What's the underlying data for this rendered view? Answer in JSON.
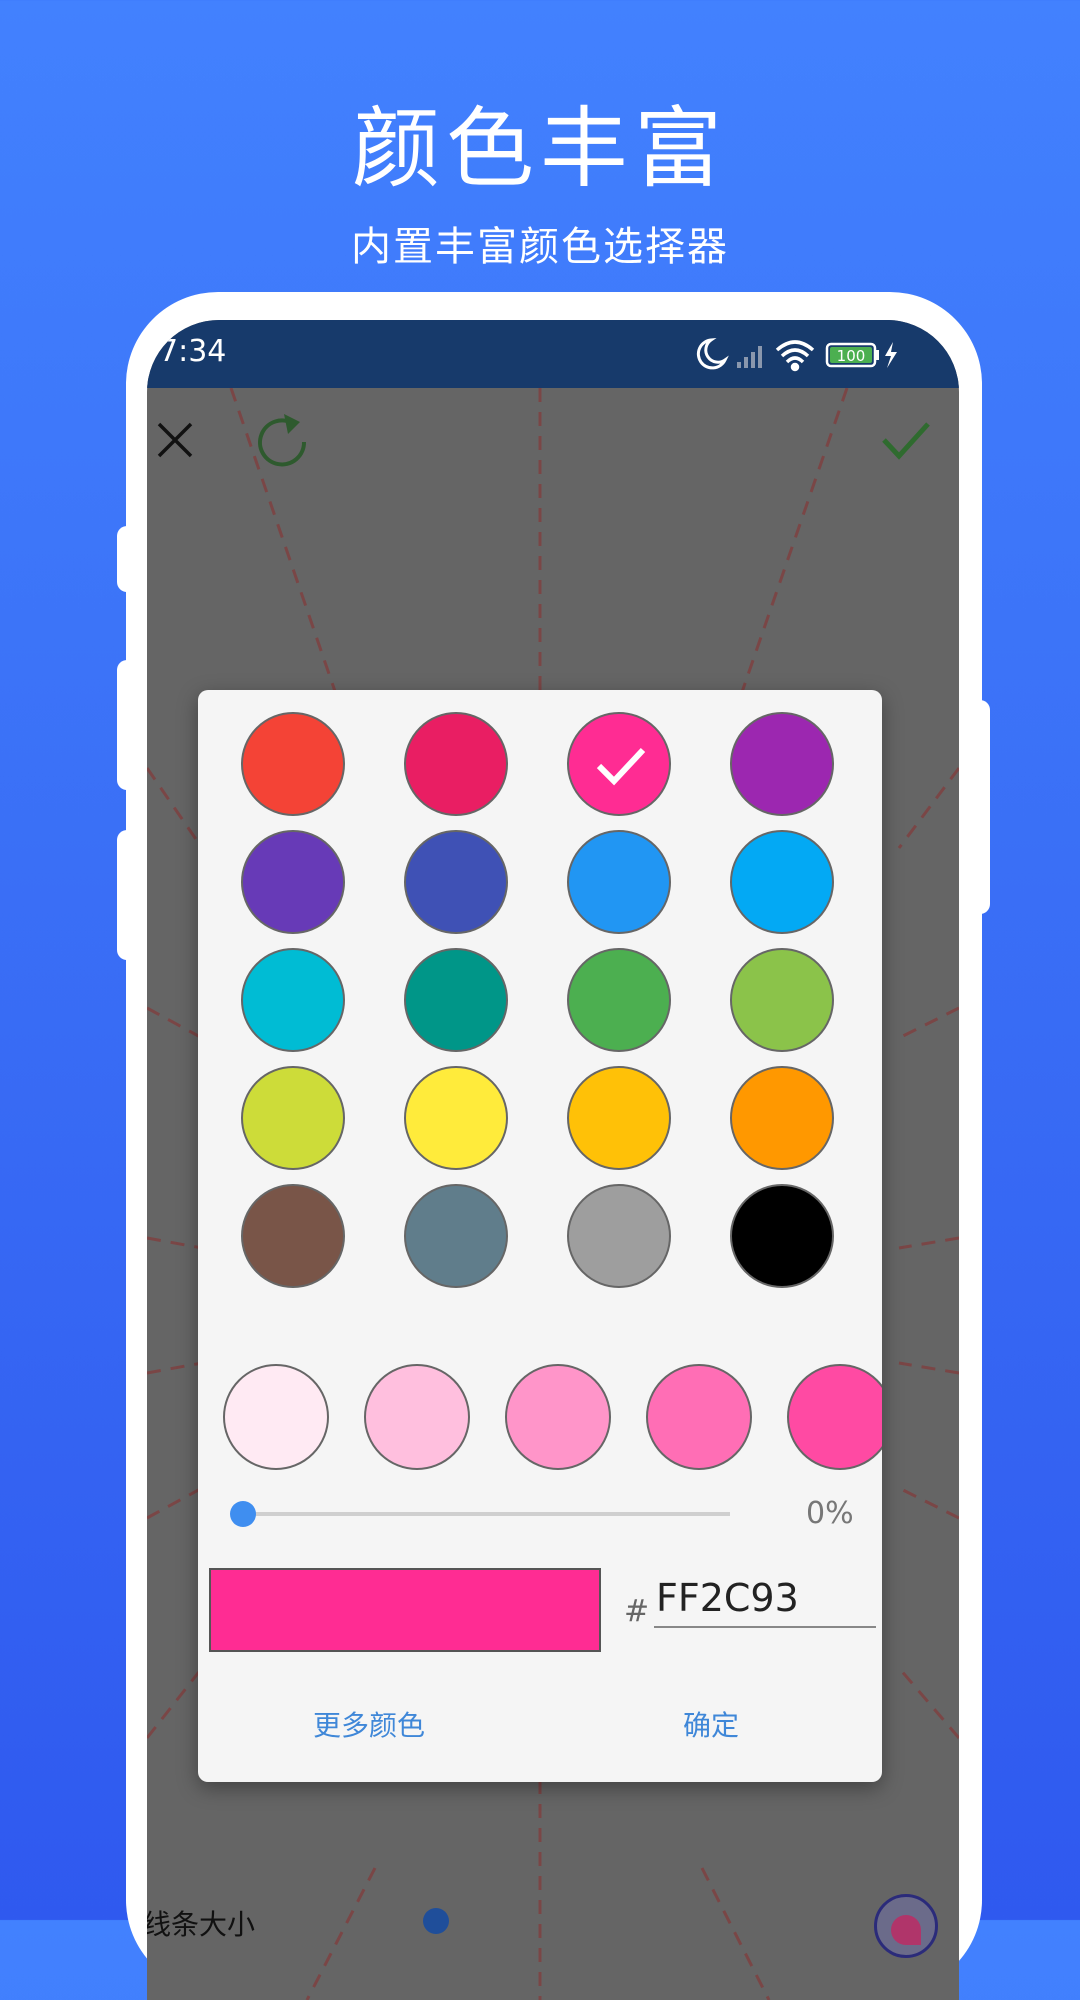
{
  "promo": {
    "title": "颜色丰富",
    "subtitle": "内置丰富颜色选择器"
  },
  "status_bar": {
    "time": "7:34",
    "battery": "100",
    "icons": [
      "moon-icon",
      "signal-icon",
      "wifi-icon",
      "battery-icon",
      "charging-icon"
    ]
  },
  "toolbar": {
    "close_icon": "close-icon",
    "reset_icon": "refresh-icon",
    "confirm_icon": "check-icon"
  },
  "color_picker": {
    "selected_color": "#FF2C93",
    "palette": [
      "#F44336",
      "#E91E63",
      "#FF2C93",
      "#9C27B0",
      "#673AB7",
      "#3F51B5",
      "#2196F3",
      "#03A9F4",
      "#00BCD4",
      "#009688",
      "#4CAF50",
      "#8BC34A",
      "#CDDC39",
      "#FFEB3B",
      "#FFC107",
      "#FF9800",
      "#795548",
      "#607D8B",
      "#9E9E9E",
      "#000000"
    ],
    "selected_index": 2,
    "shades": [
      "#FFEAF3",
      "#FFBFDE",
      "#FF95C9",
      "#FF6EB5",
      "#FF4AA3"
    ],
    "transparency_fraction": 0.0,
    "transparency_label": "0%",
    "hex_prefix": "#",
    "hex_value": "FF2C93",
    "more_colors_label": "更多颜色",
    "ok_label": "确定"
  },
  "bottom_controls": {
    "line_size_label": "线条大小"
  }
}
